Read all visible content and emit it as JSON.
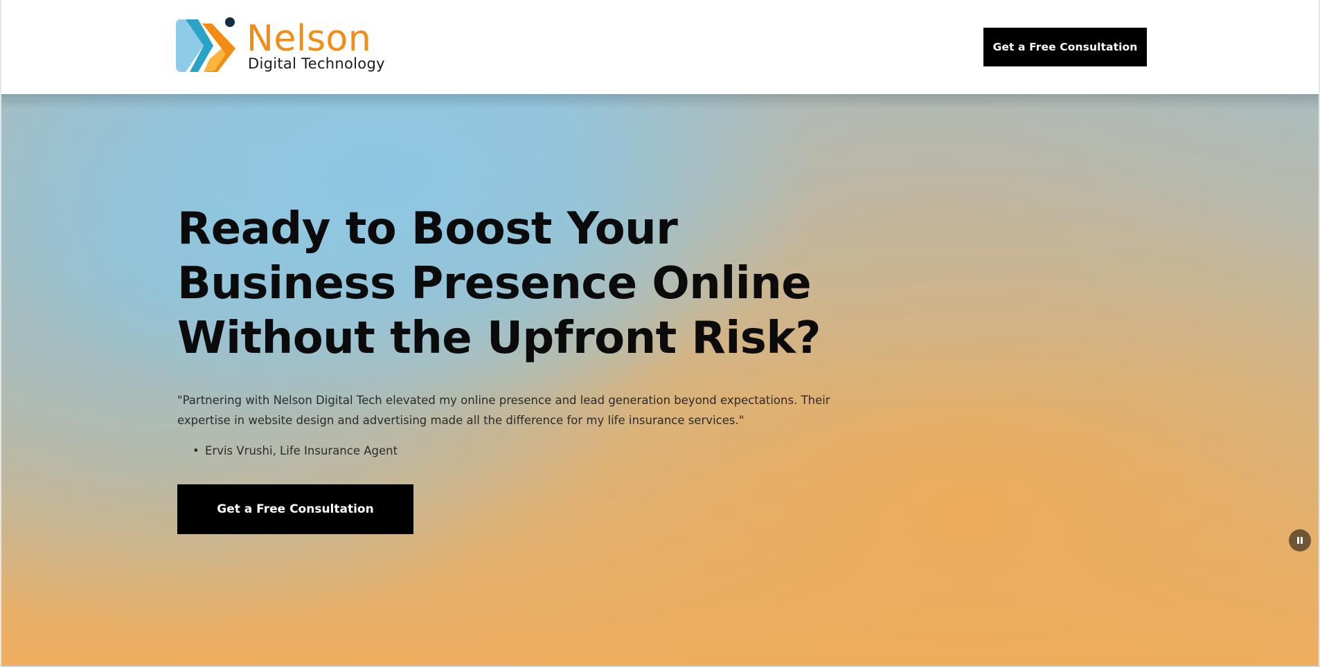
{
  "colors": {
    "brand_orange": "#f28c14",
    "brand_blue": "#2aa3c9",
    "button_bg": "#000000",
    "button_text": "#ffffff",
    "hero_blue": "#8cc7e4",
    "hero_orange": "#f1af5b"
  },
  "header": {
    "logo": {
      "icon": "nelson-logo-mark-icon",
      "name": "Nelson",
      "subtitle": "Digital Technology"
    },
    "cta_label": "Get a Free Consultation"
  },
  "hero": {
    "title": "Ready to Boost Your Business Presence Online Without the Upfront Risk?",
    "quote": "\"Partnering with Nelson Digital Tech elevated my online presence and lead generation beyond expectations. Their expertise in website design and advertising made all the difference for my life insurance services.\"",
    "attribution": "Ervis Vrushi, Life Insurance Agent",
    "cta_label": "Get a Free Consultation",
    "pause_icon": "pause-icon"
  }
}
